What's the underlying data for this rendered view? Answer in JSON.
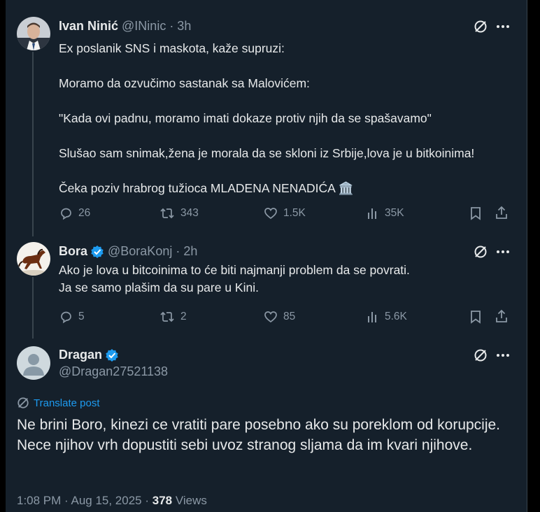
{
  "tweet1": {
    "name": "Ivan Ninić",
    "handle": "@INinic · 3h",
    "text": "Ex poslanik SNS i maskota, kaže supruzi:\n\nMoramo da ozvučimo sastanak sa Malovićem:\n\n\"Kada ovi padnu, moramo imati dokaze protiv njih da se spašavamo\"\n\nSlušao sam snimak,žena je morala da se skloni iz Srbije,lova je u bitkoinima!\n\nČeka poziv hrabrog tužioca MLADENA NENADIĆA 🏛️",
    "replies": "26",
    "reposts": "343",
    "likes": "1.5K",
    "views": "35K"
  },
  "tweet2": {
    "name": "Bora",
    "handle": "@BoraKonj · 2h",
    "text": "Ako je lova u bitcoinima to će biti najmanji problem da se povrati.\nJa se samo plašim da su pare u Kini.",
    "replies": "5",
    "reposts": "2",
    "likes": "85",
    "views": "5.6K"
  },
  "main_tweet": {
    "name": "Dragan",
    "handle": "@Dragan27521138",
    "translate_label": "Translate post",
    "text": "Ne brini Boro, kinezi ce vratiti pare posebno ako su poreklom od korupcije. Nece njihov vrh dopustiti sebi uvoz stranog sljama da im kvari njihove.",
    "timestamp": "1:08 PM · Aug 15, 2025 · ",
    "views_count": "378",
    "views_label": " Views"
  },
  "colors": {
    "background": "#15202b",
    "text": "#e7e9ea",
    "muted": "#8b98a5",
    "accent": "#1d9bf0",
    "line": "#38444d"
  },
  "icons": [
    "grok-icon",
    "more-icon",
    "reply-icon",
    "repost-icon",
    "like-icon",
    "views-icon",
    "bookmark-icon",
    "share-icon",
    "verified-badge-icon",
    "translate-icon"
  ]
}
